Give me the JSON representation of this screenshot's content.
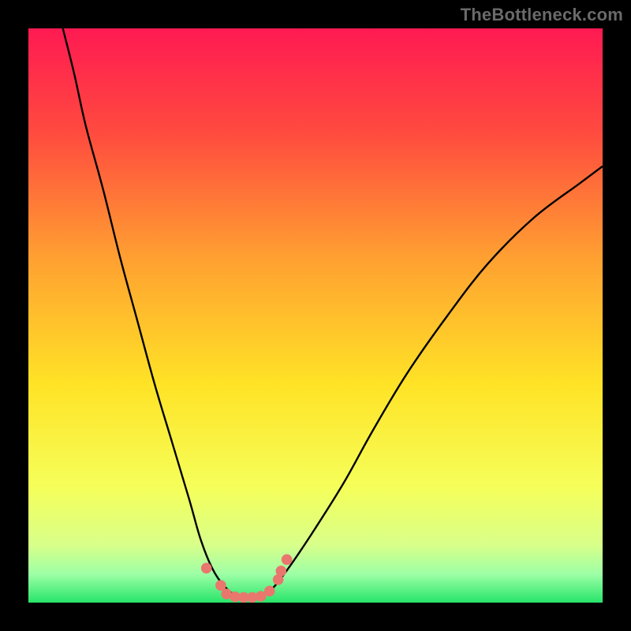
{
  "watermark": "TheBottleneck.com",
  "icon_names": {
    "gradient": "sunset-gradient",
    "curve": "bottleneck-curve",
    "dots": "bottleneck-dots"
  },
  "chart_data": {
    "type": "line",
    "title": "",
    "xlabel": "",
    "ylabel": "",
    "xlim": [
      0,
      100
    ],
    "ylim": [
      0,
      100
    ],
    "grid": false,
    "legend": null,
    "gradient_stops": [
      {
        "offset": 0.0,
        "color": "#ff1a52"
      },
      {
        "offset": 0.18,
        "color": "#ff4a3f"
      },
      {
        "offset": 0.4,
        "color": "#ffa031"
      },
      {
        "offset": 0.62,
        "color": "#ffe326"
      },
      {
        "offset": 0.8,
        "color": "#f5ff5a"
      },
      {
        "offset": 0.9,
        "color": "#d8ff8a"
      },
      {
        "offset": 0.95,
        "color": "#9effa6"
      },
      {
        "offset": 1.0,
        "color": "#27e56a"
      }
    ],
    "series": [
      {
        "name": "left-branch",
        "x": [
          6,
          8,
          10,
          13,
          16,
          19,
          22,
          25,
          28,
          30,
          32,
          34,
          36
        ],
        "y": [
          100,
          92,
          83,
          72,
          60,
          49,
          38,
          28,
          18,
          11,
          6,
          3,
          1.2
        ]
      },
      {
        "name": "right-branch",
        "x": [
          41,
          43,
          46,
          50,
          55,
          60,
          66,
          73,
          80,
          88,
          96,
          100
        ],
        "y": [
          1.2,
          3,
          7,
          13,
          21,
          30,
          40,
          50,
          59,
          67,
          73,
          76
        ]
      }
    ],
    "dots": [
      {
        "x": 31.0,
        "y": 6.0
      },
      {
        "x": 33.5,
        "y": 3.0
      },
      {
        "x": 34.5,
        "y": 1.5
      },
      {
        "x": 36.0,
        "y": 1.0
      },
      {
        "x": 37.5,
        "y": 0.9
      },
      {
        "x": 39.0,
        "y": 0.9
      },
      {
        "x": 40.5,
        "y": 1.1
      },
      {
        "x": 42.0,
        "y": 2.0
      },
      {
        "x": 43.5,
        "y": 4.0
      },
      {
        "x": 44.0,
        "y": 5.5
      },
      {
        "x": 45.0,
        "y": 7.5
      }
    ],
    "dot_color": "#e9776e",
    "curve_color": "#000000",
    "curve_width": 2.4
  }
}
